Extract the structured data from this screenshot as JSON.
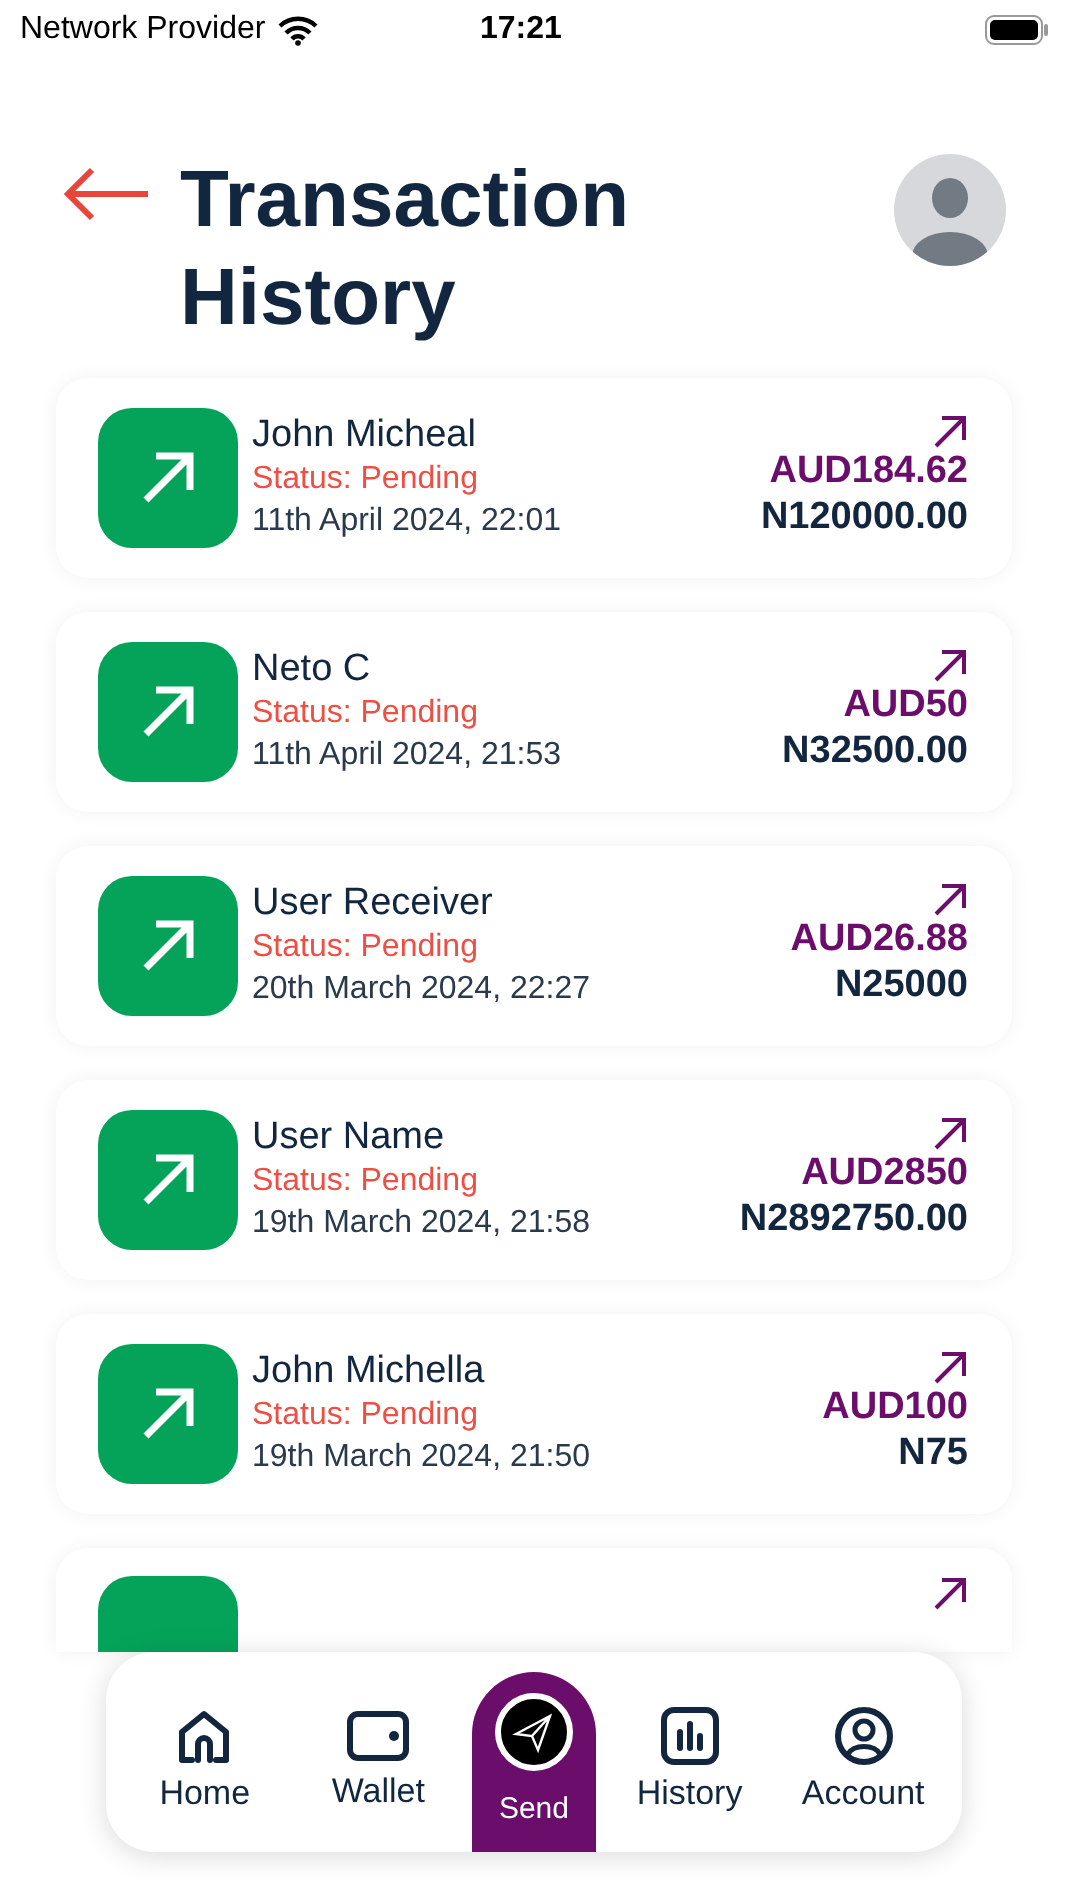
{
  "status_bar": {
    "carrier": "Network Provider",
    "time": "17:21"
  },
  "header": {
    "title": "Transaction History"
  },
  "transactions": [
    {
      "name": "John Micheal",
      "status": "Status: Pending",
      "date": "11th April 2024, 22:01",
      "amount_aud": "AUD184.62",
      "amount_ngn": "N120000.00"
    },
    {
      "name": "Neto C",
      "status": "Status: Pending",
      "date": "11th April 2024, 21:53",
      "amount_aud": "AUD50",
      "amount_ngn": "N32500.00"
    },
    {
      "name": "User Receiver",
      "status": "Status: Pending",
      "date": "20th March 2024, 22:27",
      "amount_aud": "AUD26.88",
      "amount_ngn": "N25000"
    },
    {
      "name": "User Name",
      "status": "Status: Pending",
      "date": "19th March 2024, 21:58",
      "amount_aud": "AUD2850",
      "amount_ngn": "N2892750.00"
    },
    {
      "name": "John Michella",
      "status": "Status: Pending",
      "date": "19th March 2024, 21:50",
      "amount_aud": "AUD100",
      "amount_ngn": "N75"
    },
    {
      "kind": "partial"
    }
  ],
  "bottom_nav": [
    {
      "label": "Home",
      "kind": "tab"
    },
    {
      "label": "Wallet",
      "kind": "tab"
    },
    {
      "label": "Send",
      "kind": "action"
    },
    {
      "label": "History",
      "kind": "tab"
    },
    {
      "label": "Account",
      "kind": "tab"
    }
  ]
}
